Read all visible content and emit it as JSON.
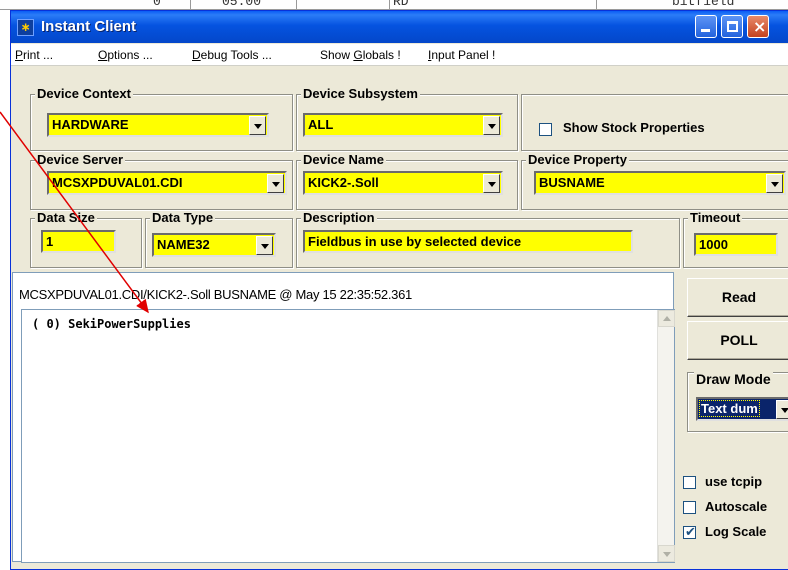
{
  "background_sheet": {
    "cells": [
      "0",
      "05:00",
      "RD",
      "bitfield <StrBit>"
    ]
  },
  "window": {
    "title": "Instant Client",
    "app_icon_glyph": "∗"
  },
  "menu": {
    "items": [
      {
        "pre": "",
        "u": "P",
        "post": "rint ..."
      },
      {
        "pre": "",
        "u": "O",
        "post": "ptions ..."
      },
      {
        "pre": "",
        "u": "D",
        "post": "ebug Tools ..."
      },
      {
        "pre": "Show ",
        "u": "G",
        "post": "lobals !"
      },
      {
        "pre": "",
        "u": "I",
        "post": "nput Panel !"
      }
    ]
  },
  "device_context": {
    "label": "Device Context",
    "value": "HARDWARE"
  },
  "device_subsystem": {
    "label": "Device Subsystem",
    "value": "ALL"
  },
  "stock_properties": {
    "label": "Show Stock Properties",
    "checked": false
  },
  "device_server": {
    "label": "Device Server",
    "value": "MCSXPDUVAL01.CDI"
  },
  "device_name": {
    "label": "Device Name",
    "value": "KICK2-.Soll"
  },
  "device_property": {
    "label": "Device Property",
    "value": "BUSNAME"
  },
  "data_size": {
    "label": "Data Size",
    "value": "1"
  },
  "data_type": {
    "label": "Data Type",
    "value": "NAME32"
  },
  "description": {
    "label": "Description",
    "value": "Fieldbus in use by selected device"
  },
  "timeout": {
    "label": "Timeout",
    "value": "1000"
  },
  "result": {
    "header": "MCSXPDUVAL01.CDI/KICK2-.Soll BUSNAME @ May 15 22:35:52.361",
    "content": "( 0) SekiPowerSupplies"
  },
  "buttons": {
    "read": "Read",
    "poll": "POLL"
  },
  "draw_mode": {
    "label": "Draw Mode",
    "value": "Text dum"
  },
  "options": {
    "use_tcpip": {
      "label": "use tcpip",
      "checked": false
    },
    "autoscale": {
      "label": "Autoscale",
      "checked": false
    },
    "log_scale": {
      "label": "Log Scale",
      "checked": true
    }
  },
  "colors": {
    "titlebar": "#0553e0",
    "field_yellow": "#ffff00",
    "dialog_bg": "#ece9d8",
    "annotation_arrow": "#e00000",
    "selection_blue": "#0a246a"
  }
}
